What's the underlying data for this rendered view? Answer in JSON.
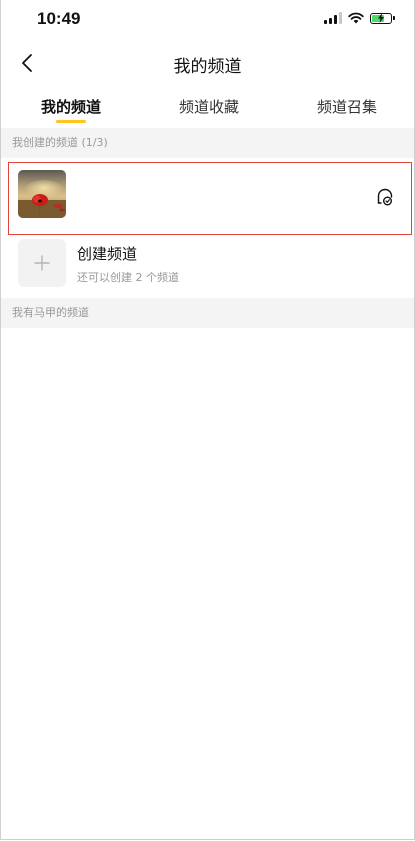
{
  "status_bar": {
    "time": "10:49",
    "icons": [
      "signal-icon",
      "wifi-icon",
      "battery-charging-icon"
    ]
  },
  "nav": {
    "title": "我的频道",
    "back_icon": "chevron-left-icon"
  },
  "tabs": [
    {
      "label": "我的频道",
      "active": true
    },
    {
      "label": "频道收藏",
      "active": false
    },
    {
      "label": "频道召集",
      "active": false
    }
  ],
  "sections": {
    "created_header": "我创建的频道 (1/3)",
    "vest_header": "我有马甲的频道"
  },
  "channel": {
    "thumbnail": "red-poppy-field-image",
    "action_icon": "channel-manage-icon"
  },
  "create": {
    "title": "创建频道",
    "subtitle": "还可以创建 2 个频道",
    "icon": "plus-icon"
  },
  "colors": {
    "tab_indicator": "#ffc51c",
    "highlight_border": "#e0443c",
    "section_bg": "#f4f4f4",
    "battery": "#4cd964"
  }
}
